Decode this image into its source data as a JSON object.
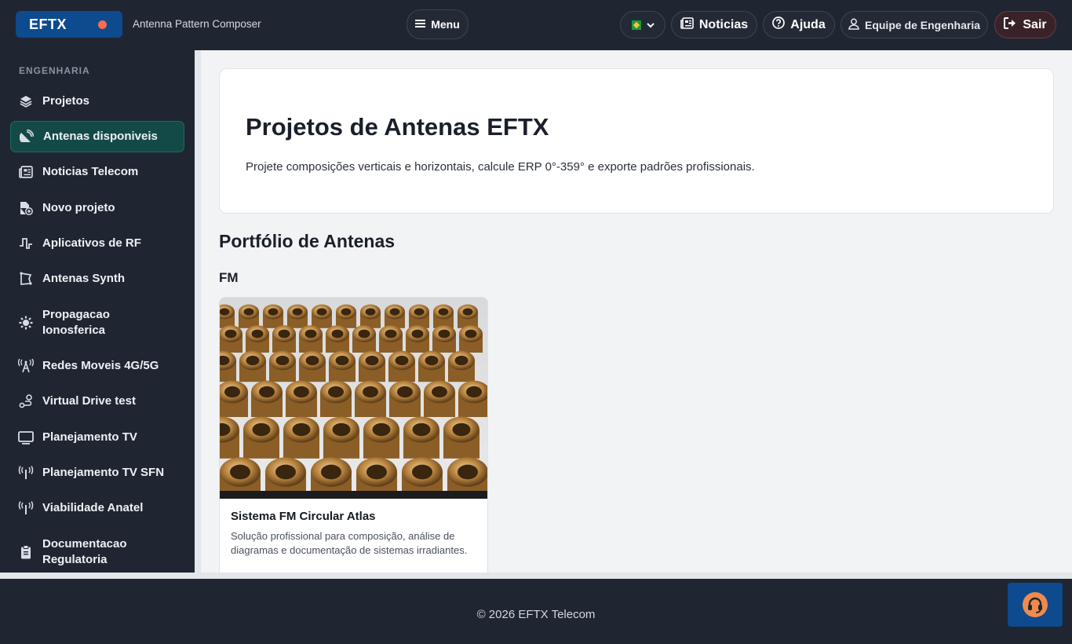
{
  "header": {
    "brand": "EFTX",
    "app_subtitle": "Antenna Pattern Composer",
    "menu_label": "Menu",
    "news_label": "Noticias",
    "help_label": "Ajuda",
    "team_label": "Equipe de Engenharia",
    "logout_label": "Sair",
    "language_icon": "brazil-flag-icon",
    "accent_color": "#0d4a8e",
    "status_dot_color": "#ff6b4a"
  },
  "sidebar": {
    "section": "ENGENHARIA",
    "items": [
      {
        "label": "Projetos",
        "icon": "layers-icon"
      },
      {
        "label": "Antenas disponiveis",
        "icon": "satellite-dish-icon",
        "active": true
      },
      {
        "label": "Noticias Telecom",
        "icon": "newspaper-icon"
      },
      {
        "label": "Novo projeto",
        "icon": "file-plus-icon"
      },
      {
        "label": "Aplicativos de RF",
        "icon": "pulse-wave-icon"
      },
      {
        "label": "Antenas Synth",
        "icon": "frame-icon"
      },
      {
        "label": "Propagacao Ionosferica",
        "icon": "sun-gear-icon"
      },
      {
        "label": "Redes Moveis 4G/5G",
        "icon": "cell-tower-icon"
      },
      {
        "label": "Virtual Drive test",
        "icon": "route-icon"
      },
      {
        "label": "Planejamento TV",
        "icon": "monitor-icon"
      },
      {
        "label": "Planejamento TV SFN",
        "icon": "broadcast-icon"
      },
      {
        "label": "Viabilidade Anatel",
        "icon": "broadcast-icon"
      },
      {
        "label": "Documentacao Regulatoria",
        "icon": "clipboard-icon"
      }
    ]
  },
  "main": {
    "hero_title": "Projetos de Antenas EFTX",
    "hero_subtitle": "Projete composições verticais e horizontais, calcule ERP 0°-359° e exporte padrões profissionais.",
    "portfolio_title": "Portfólio de Antenas",
    "category": "FM",
    "card": {
      "title": "Sistema FM Circular Atlas",
      "description": "Solução profissional para composição, análise de diagramas e documentação de sistemas irradiantes."
    }
  },
  "footer": {
    "copyright": "© 2026 EFTX Telecom",
    "support_icon": "headset-icon"
  }
}
